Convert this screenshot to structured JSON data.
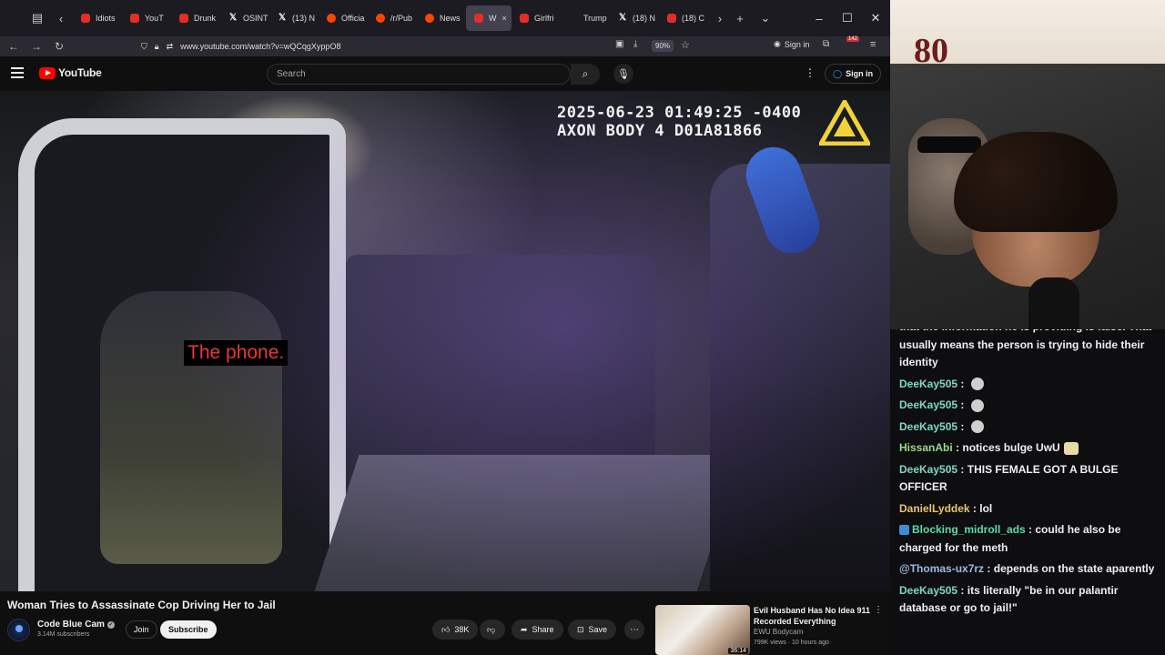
{
  "browser": {
    "tabs": [
      {
        "label": "Idiots",
        "favicon": "youtube-icon"
      },
      {
        "label": "YouT",
        "favicon": "youtube-icon"
      },
      {
        "label": "Drunk",
        "favicon": "youtube-icon"
      },
      {
        "label": "OSINT",
        "favicon": "x-icon"
      },
      {
        "label": "(13) N",
        "favicon": "x-icon"
      },
      {
        "label": "Officia",
        "favicon": "reddit-icon"
      },
      {
        "label": "/r/Pub",
        "favicon": "reddit-icon"
      },
      {
        "label": "News",
        "favicon": "reddit-icon"
      },
      {
        "label": "W",
        "favicon": "youtube-icon",
        "active": true
      },
      {
        "label": "Girlfri",
        "favicon": "youtube-icon"
      },
      {
        "label": "Trump",
        "favicon": "page-icon"
      },
      {
        "label": "(18) N",
        "favicon": "x-icon"
      },
      {
        "label": "(18) C",
        "favicon": "youtube-icon"
      }
    ],
    "url": "www.youtube.com/watch?v=wQCqgXyppO8",
    "zoom": "90%",
    "signin": "Sign in",
    "extension_badge": "142"
  },
  "youtube": {
    "logo": "YouTube",
    "search_placeholder": "Search",
    "signin": "Sign in"
  },
  "video": {
    "timestamp_line1": "2025-06-23 01:49:25 -0400",
    "timestamp_line2": "AXON BODY 4 D01A81866",
    "caption": "The phone.",
    "title": "Woman Tries to Assassinate Cop Driving Her to Jail",
    "channel": "Code Blue Cam",
    "subscribers": "3.14M subscribers",
    "join": "Join",
    "subscribe": "Subscribe",
    "likes": "38K",
    "share": "Share",
    "save": "Save"
  },
  "recommended": {
    "title": "Evil Husband Has No Idea 911 Recorded Everything",
    "channel": "EWU Bodycam",
    "meta": "799K views · 10 hours ago",
    "duration": "36:14"
  },
  "webcam": {
    "wall_text": "80"
  },
  "chat": {
    "messages": [
      {
        "user": "",
        "text": "that the information he is providing is false. That usually means the person is trying to hide their identity",
        "color": "#efeff1"
      },
      {
        "user": "DeeKay505",
        "text": "",
        "emote": true,
        "color": "#7fd9c2"
      },
      {
        "user": "DeeKay505",
        "text": "",
        "emote": true,
        "color": "#7fd9c2"
      },
      {
        "user": "DeeKay505",
        "text": "",
        "emote": true,
        "color": "#7fd9c2"
      },
      {
        "user": "HissanAbi",
        "text": "notices bulge UwU",
        "emote_wide": true,
        "color": "#9ad88a"
      },
      {
        "user": "DeeKay505",
        "text": "THIS FEMALE GOT A BULGE OFFICER",
        "color": "#7fd9c2"
      },
      {
        "user": "DanielLyddek",
        "text": "lol",
        "color": "#e6c27a"
      },
      {
        "user": "Blocking_midroll_ads",
        "text": "could he also be charged for the meth",
        "badge": true,
        "color": "#5fd8a8"
      },
      {
        "user": "@Thomas-ux7rz",
        "text": "depends on the state aparently",
        "color": "#9fb8e8"
      },
      {
        "user": "DeeKay505",
        "text": "its literally \"be in our palantir database or go to jail!\"",
        "color": "#7fd9c2"
      }
    ]
  }
}
